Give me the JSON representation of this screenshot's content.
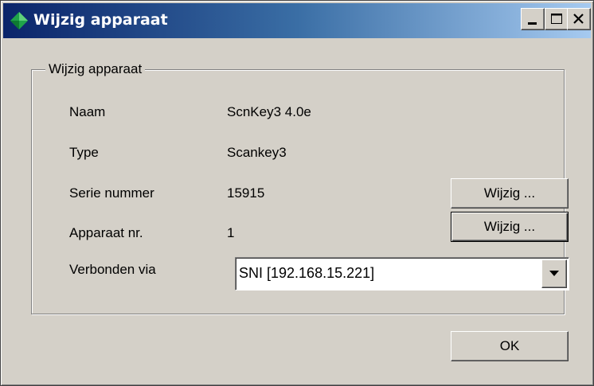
{
  "window": {
    "title": "Wijzig apparaat",
    "title_icon": "green-diamond-icon",
    "controls": [
      "minimize-icon",
      "maximize-icon",
      "close-icon"
    ]
  },
  "group": {
    "legend": "Wijzig apparaat"
  },
  "fields": {
    "name_label": "Naam",
    "name_value": "ScnKey3 4.0e",
    "type_label": "Type",
    "type_value": "Scankey3",
    "serial_label": "Serie nummer",
    "serial_value": "15915",
    "serial_change_label": "Wijzig ...",
    "device_label": "Apparaat nr.",
    "device_value": "1",
    "device_change_label": "Wijzig ...",
    "connection_label": "Verbonden via",
    "connection_value": "SNI [192.168.15.221]"
  },
  "footer": {
    "ok_label": "OK"
  },
  "colors": {
    "window_face": "#d4d0c8",
    "title_gradient_start": "#0a246a",
    "title_gradient_end": "#a6caf0",
    "icon_green": "#1fa34a"
  }
}
